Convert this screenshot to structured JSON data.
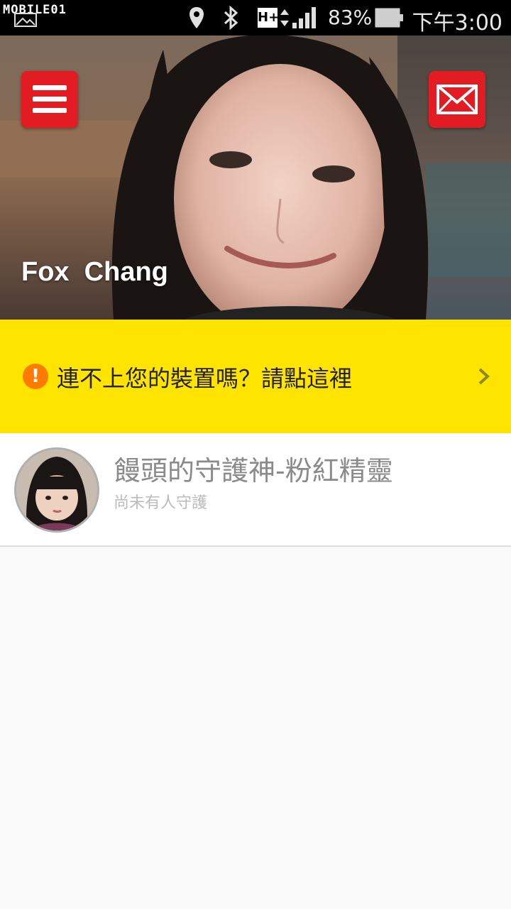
{
  "status_bar": {
    "watermark": "MOBILE01",
    "network_type": "H+",
    "battery_percent": "83%",
    "time": "下午3:00",
    "icons": [
      "photo-icon",
      "location-icon",
      "bluetooth-icon",
      "data-arrows-icon",
      "signal-icon",
      "battery-icon"
    ]
  },
  "header": {
    "user_name": "Fox  Chang",
    "menu_icon": "hamburger-menu-icon",
    "mail_icon": "envelope-icon",
    "accent_color": "#e31b23"
  },
  "alert": {
    "icon": "exclamation-icon",
    "text": "連不上您的裝置嗎？請點這裡",
    "background": "#ffe400",
    "icon_color": "#ff7a00"
  },
  "devices": [
    {
      "title": "饅頭的守護神-粉紅精靈",
      "subtitle": "尚未有人守護"
    }
  ]
}
